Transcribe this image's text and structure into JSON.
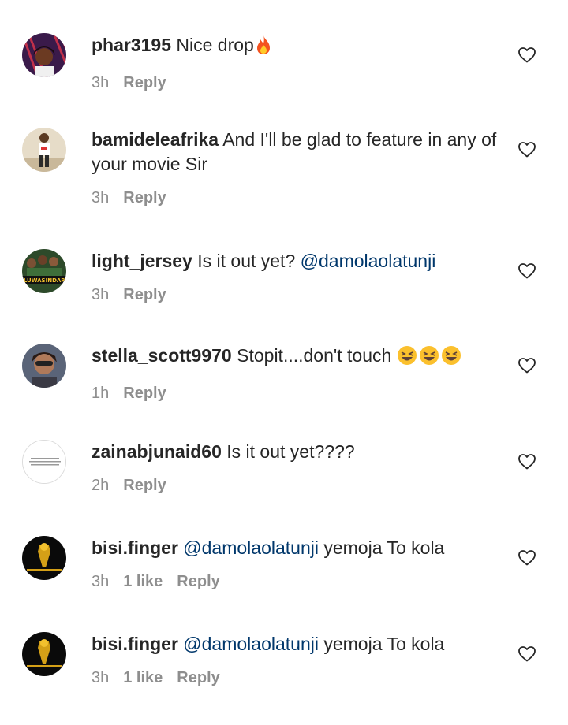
{
  "comments": [
    {
      "username": "phar3195",
      "text": "Nice drop",
      "emoji_icon": "fire-emoji",
      "time": "3h",
      "reply": "Reply"
    },
    {
      "username": "bamideleafrika",
      "text": "And I'll be glad to feature in any of your movie Sir",
      "time": "3h",
      "reply": "Reply"
    },
    {
      "username": "light_jersey",
      "text": "Is it out yet?",
      "mention": "@damolaolatunji",
      "time": "3h",
      "reply": "Reply"
    },
    {
      "username": "stella_scott9970",
      "text": "Stopit....don't touch",
      "emoji_icon": "laughing-emoji",
      "time": "1h",
      "reply": "Reply"
    },
    {
      "username": "zainabjunaid60",
      "text": "Is it out yet????",
      "time": "2h",
      "reply": "Reply"
    },
    {
      "username": "bisi.finger",
      "mention": "@damolaolatunji",
      "text": "yemoja To kola",
      "time": "3h",
      "likes": "1 like",
      "reply": "Reply"
    },
    {
      "username": "bisi.finger",
      "mention": "@damolaolatunji",
      "text": "yemoja To kola",
      "time": "3h",
      "likes": "1 like",
      "reply": "Reply"
    }
  ],
  "colors": {
    "text": "#262626",
    "secondary": "#8e8e8e",
    "mention": "#00376b"
  }
}
